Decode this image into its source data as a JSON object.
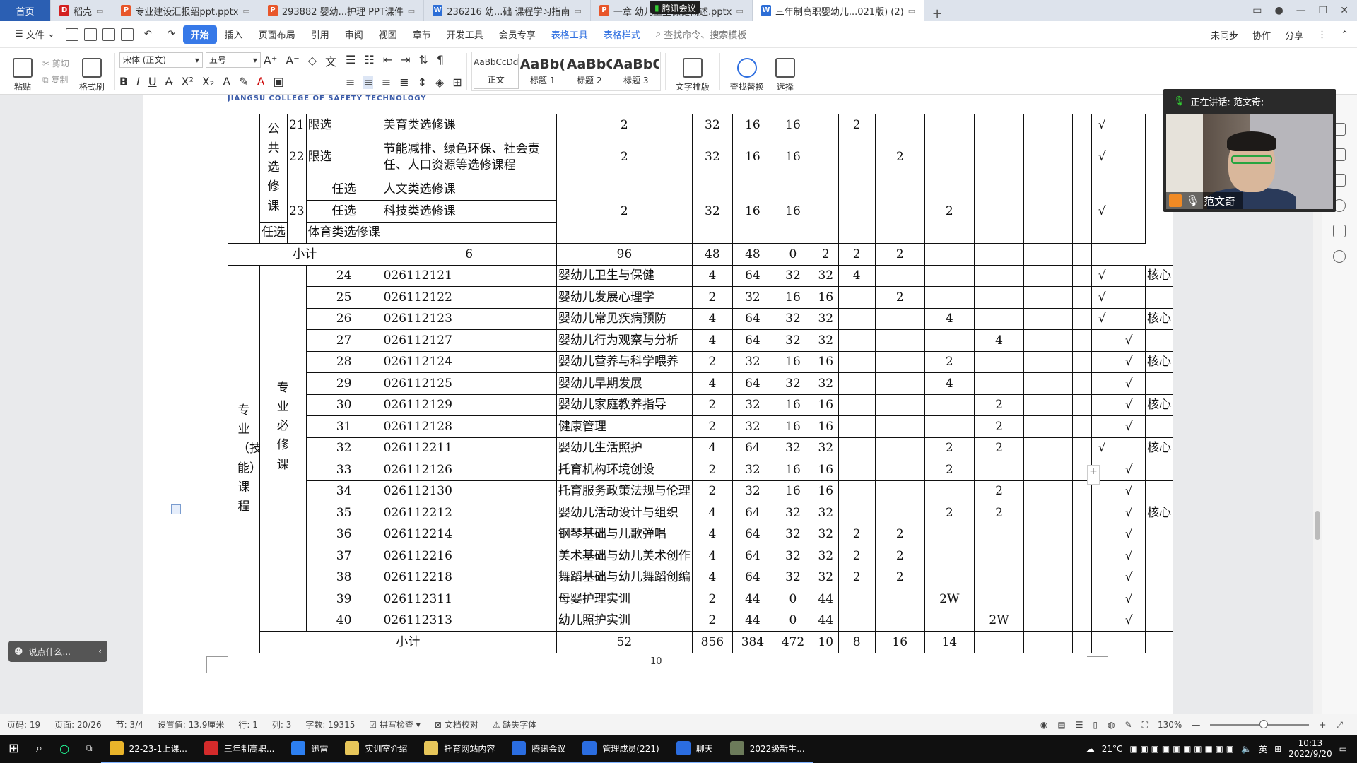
{
  "tabs": [
    {
      "label": "首页",
      "icon": "",
      "kind": "home"
    },
    {
      "label": "稻壳",
      "icon": "k",
      "kind": "tab"
    },
    {
      "label": "专业建设汇报绍ppt.pptx",
      "icon": "p",
      "kind": "tab"
    },
    {
      "label": "293882 婴幼...护理 PPT课件",
      "icon": "p",
      "kind": "tab"
    },
    {
      "label": "236216  幼...础  课程学习指南",
      "icon": "w",
      "kind": "tab"
    },
    {
      "label": "一章 幼儿卫生保健概述.pptx",
      "icon": "p",
      "kind": "tab"
    },
    {
      "label": "三年制高职婴幼儿...021版) (2)",
      "icon": "w",
      "kind": "active"
    }
  ],
  "meeting_overlay_title": "腾讯会议",
  "menu": {
    "file": "文件",
    "items": [
      "开始",
      "插入",
      "页面布局",
      "引用",
      "审阅",
      "视图",
      "章节",
      "开发工具",
      "会员专享",
      "表格工具",
      "表格样式"
    ],
    "search": "查找命令、搜索模板",
    "right": [
      "未同步",
      "协作",
      "分享"
    ]
  },
  "ribbon": {
    "paste": "粘贴",
    "cut": "剪切",
    "copy": "复制",
    "format_painter": "格式刷",
    "font": "宋体 (正文)",
    "size": "五号",
    "styles": [
      {
        "preview": "AaBbCcDd",
        "name": "正文"
      },
      {
        "preview": "AaBb(",
        "name": "标题 1"
      },
      {
        "preview": "AaBbC",
        "name": "标题 2"
      },
      {
        "preview": "AaBbC",
        "name": "标题 3"
      }
    ],
    "text_layout": "文字排版",
    "find_replace": "查找替换",
    "select": "选择"
  },
  "page_header": "JIANGSU COLLEGE OF SAFETY TECHNOLOGY",
  "table": {
    "public": {
      "group": "公共选修课",
      "rows": [
        {
          "no": "21",
          "code": "限选",
          "name": "美育类选修课",
          "credit": "2",
          "hours": "32",
          "theory": "16",
          "practice": "16",
          "s1": "",
          "s2": "2",
          "s3": "",
          "s4": "",
          "s5": "",
          "s6": "",
          "a": "",
          "b": "√",
          "c": ""
        },
        {
          "no": "22",
          "code": "限选",
          "name": "节能减排、绿色环保、社会责任、人口资源等选修课程",
          "credit": "2",
          "hours": "32",
          "theory": "16",
          "practice": "16",
          "s1": "",
          "s2": "",
          "s3": "2",
          "s4": "",
          "s5": "",
          "s6": "",
          "a": "",
          "b": "√",
          "c": ""
        }
      ],
      "row23": {
        "no": "23",
        "subs": [
          {
            "code": "任选",
            "name": "人文类选修课"
          },
          {
            "code": "任选",
            "name": "科技类选修课"
          },
          {
            "code": "任选",
            "name": "体育类选修课"
          }
        ],
        "credit": "2",
        "hours": "32",
        "theory": "16",
        "practice": "16",
        "s1": "",
        "s2": "",
        "s3": "",
        "s4": "2",
        "s5": "",
        "s6": "",
        "a": "",
        "b": "√",
        "c": ""
      },
      "subtotal": {
        "label": "小计",
        "credit": "6",
        "hours": "96",
        "theory": "48",
        "practice": "48",
        "s1": "0",
        "s2": "2",
        "s3": "2",
        "s4": "2"
      }
    },
    "professional": {
      "group": "专业（技能）课程",
      "subgroup": "专业必修课",
      "rows": [
        {
          "no": "24",
          "code": "026112121",
          "name": "婴幼儿卫生与保健",
          "credit": "4",
          "hours": "64",
          "theory": "32",
          "practice": "32",
          "s1": "4",
          "s2": "",
          "s3": "",
          "s4": "",
          "s5": "",
          "s6": "",
          "a": "√",
          "b": "",
          "c": "核心"
        },
        {
          "no": "25",
          "code": "026112122",
          "name": "婴幼儿发展心理学",
          "credit": "2",
          "hours": "32",
          "theory": "16",
          "practice": "16",
          "s1": "",
          "s2": "2",
          "s3": "",
          "s4": "",
          "s5": "",
          "s6": "",
          "a": "√",
          "b": "",
          "c": ""
        },
        {
          "no": "26",
          "code": "026112123",
          "name": "婴幼儿常见疾病预防",
          "credit": "4",
          "hours": "64",
          "theory": "32",
          "practice": "32",
          "s1": "",
          "s2": "",
          "s3": "4",
          "s4": "",
          "s5": "",
          "s6": "",
          "a": "√",
          "b": "",
          "c": "核心"
        },
        {
          "no": "27",
          "code": "026112127",
          "name": "婴幼儿行为观察与分析",
          "credit": "4",
          "hours": "64",
          "theory": "32",
          "practice": "32",
          "s1": "",
          "s2": "",
          "s3": "",
          "s4": "4",
          "s5": "",
          "s6": "",
          "a": "",
          "b": "√",
          "c": ""
        },
        {
          "no": "28",
          "code": "026112124",
          "name": "婴幼儿营养与科学喂养",
          "credit": "2",
          "hours": "32",
          "theory": "16",
          "practice": "16",
          "s1": "",
          "s2": "",
          "s3": "2",
          "s4": "",
          "s5": "",
          "s6": "",
          "a": "",
          "b": "√",
          "c": "核心"
        },
        {
          "no": "29",
          "code": "026112125",
          "name": "婴幼儿早期发展",
          "credit": "4",
          "hours": "64",
          "theory": "32",
          "practice": "32",
          "s1": "",
          "s2": "",
          "s3": "4",
          "s4": "",
          "s5": "",
          "s6": "",
          "a": "",
          "b": "√",
          "c": ""
        },
        {
          "no": "30",
          "code": "026112129",
          "name": "婴幼儿家庭教养指导",
          "credit": "2",
          "hours": "32",
          "theory": "16",
          "practice": "16",
          "s1": "",
          "s2": "",
          "s3": "",
          "s4": "2",
          "s5": "",
          "s6": "",
          "a": "",
          "b": "√",
          "c": "核心"
        },
        {
          "no": "31",
          "code": "026112128",
          "name": "健康管理",
          "credit": "2",
          "hours": "32",
          "theory": "16",
          "practice": "16",
          "s1": "",
          "s2": "",
          "s3": "",
          "s4": "2",
          "s5": "",
          "s6": "",
          "a": "",
          "b": "√",
          "c": ""
        },
        {
          "no": "32",
          "code": "026112211",
          "name": "婴幼儿生活照护",
          "credit": "4",
          "hours": "64",
          "theory": "32",
          "practice": "32",
          "s1": "",
          "s2": "",
          "s3": "2",
          "s4": "2",
          "s5": "",
          "s6": "",
          "a": "√",
          "b": "",
          "c": "核心"
        },
        {
          "no": "33",
          "code": "026112126",
          "name": "托育机构环境创设",
          "credit": "2",
          "hours": "32",
          "theory": "16",
          "practice": "16",
          "s1": "",
          "s2": "",
          "s3": "2",
          "s4": "",
          "s5": "",
          "s6": "",
          "a": "",
          "b": "√",
          "c": ""
        },
        {
          "no": "34",
          "code": "026112130",
          "name": "托育服务政策法规与伦理",
          "credit": "2",
          "hours": "32",
          "theory": "16",
          "practice": "16",
          "s1": "",
          "s2": "",
          "s3": "",
          "s4": "2",
          "s5": "",
          "s6": "",
          "a": "",
          "b": "√",
          "c": ""
        },
        {
          "no": "35",
          "code": "026112212",
          "name": "婴幼儿活动设计与组织",
          "credit": "4",
          "hours": "64",
          "theory": "32",
          "practice": "32",
          "s1": "",
          "s2": "",
          "s3": "2",
          "s4": "2",
          "s5": "",
          "s6": "",
          "a": "",
          "b": "√",
          "c": "核心"
        },
        {
          "no": "36",
          "code": "026112214",
          "name": "钢琴基础与儿歌弹唱",
          "credit": "4",
          "hours": "64",
          "theory": "32",
          "practice": "32",
          "s1": "2",
          "s2": "2",
          "s3": "",
          "s4": "",
          "s5": "",
          "s6": "",
          "a": "",
          "b": "√",
          "c": ""
        },
        {
          "no": "37",
          "code": "026112216",
          "name": "美术基础与幼儿美术创作",
          "credit": "4",
          "hours": "64",
          "theory": "32",
          "practice": "32",
          "s1": "2",
          "s2": "2",
          "s3": "",
          "s4": "",
          "s5": "",
          "s6": "",
          "a": "",
          "b": "√",
          "c": ""
        },
        {
          "no": "38",
          "code": "026112218",
          "name": "舞蹈基础与幼儿舞蹈创编",
          "credit": "4",
          "hours": "64",
          "theory": "32",
          "practice": "32",
          "s1": "2",
          "s2": "2",
          "s3": "",
          "s4": "",
          "s5": "",
          "s6": "",
          "a": "",
          "b": "√",
          "c": ""
        }
      ],
      "practice_rows": [
        {
          "no": "39",
          "code": "026112311",
          "name": "母婴护理实训",
          "credit": "2",
          "hours": "44",
          "theory": "0",
          "practice": "44",
          "s1": "",
          "s2": "",
          "s3": "2W",
          "s4": "",
          "s5": "",
          "s6": "",
          "a": "",
          "b": "√",
          "c": ""
        },
        {
          "no": "40",
          "code": "026112313",
          "name": "幼儿照护实训",
          "credit": "2",
          "hours": "44",
          "theory": "0",
          "practice": "44",
          "s1": "",
          "s2": "",
          "s3": "",
          "s4": "2W",
          "s5": "",
          "s6": "",
          "a": "",
          "b": "√",
          "c": ""
        }
      ],
      "subtotal": {
        "label": "小计",
        "credit": "52",
        "hours": "856",
        "theory": "384",
        "practice": "472",
        "s1": "10",
        "s2": "8",
        "s3": "16",
        "s4": "14"
      }
    }
  },
  "page_number": "10",
  "comment_placeholder": "说点什么...",
  "meeting": {
    "speaking": "正在讲话: 范文奇;",
    "name": "范文奇"
  },
  "status": {
    "page_code": "页码: 19",
    "pages": "页面: 20/26",
    "section": "节: 3/4",
    "position": "设置值: 13.9厘米",
    "row": "行: 1",
    "col": "列: 3",
    "words": "字数: 19315",
    "spell": "拼写检查",
    "proof": "文档校对",
    "missing_font": "缺失字体",
    "zoom": "130%"
  },
  "taskbar": {
    "apps": [
      {
        "label": "22-23-1上课...",
        "color": "#e9b42a"
      },
      {
        "label": "三年制高职...",
        "color": "#d42b2b"
      },
      {
        "label": "迅雷",
        "color": "#2d7ff0"
      },
      {
        "label": "实训室介绍",
        "color": "#e7c65a"
      },
      {
        "label": "托育网站内容",
        "color": "#e7c65a"
      },
      {
        "label": "腾讯会议",
        "color": "#2b6de0"
      },
      {
        "label": "管理成员(221)",
        "color": "#2b6de0"
      },
      {
        "label": "聊天",
        "color": "#2b6de0"
      },
      {
        "label": "2022级新生...",
        "color": "#6c7b5a"
      }
    ],
    "weather": "21°C",
    "ime": "英",
    "time": "10:13",
    "date": "2022/9/20"
  }
}
